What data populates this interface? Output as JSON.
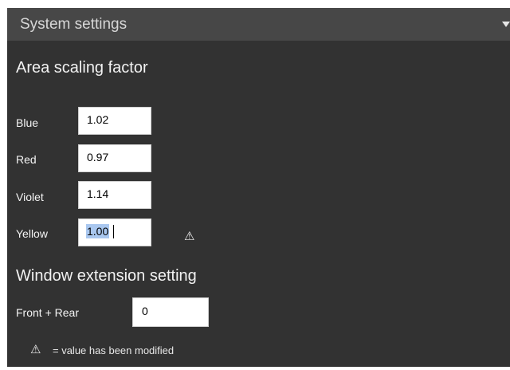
{
  "header": {
    "title": "System settings",
    "collapse_icon": "chevron-down-icon"
  },
  "area_scaling": {
    "title": "Area scaling factor",
    "rows": [
      {
        "label": "Blue",
        "value": "1.02"
      },
      {
        "label": "Red",
        "value": "0.97"
      },
      {
        "label": "Violet",
        "value": "1.14"
      },
      {
        "label": "Yellow",
        "value": "1.00",
        "modified": true,
        "selected": true
      }
    ]
  },
  "window_extension": {
    "title": "Window extension setting",
    "rows": [
      {
        "label": "Front + Rear",
        "value": "0"
      }
    ]
  },
  "icons": {
    "modified": "warning-triangle-icon",
    "modified_glyph": "⚠"
  },
  "legend": {
    "text": "= value has been modified"
  },
  "colors": {
    "panel_bg": "#323232",
    "header_bg": "#474747",
    "selection": "#a9c7ef"
  }
}
